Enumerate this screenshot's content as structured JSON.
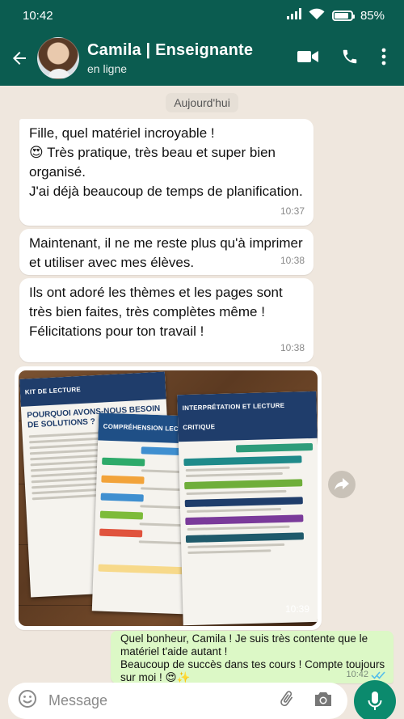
{
  "status_bar": {
    "time": "10:42",
    "battery": "85%",
    "battery_level": 0.85
  },
  "header": {
    "name": "Camila | Enseignante",
    "status": "en ligne"
  },
  "chat": {
    "date": "Aujourd'hui",
    "messages": [
      {
        "text": "Fille, quel matériel incroyable !\n😍 Très pratique, très beau et super bien organisé.\nJ'ai déjà beaucoup de temps de planification.",
        "time": "10:37"
      },
      {
        "text": "Maintenant, il ne me reste plus qu'à imprimer et utiliser avec mes élèves.",
        "time": "10:38"
      },
      {
        "text": "Ils ont adoré les thèmes et les pages sont très bien faites, très complètes même !\nFélicitations pour ton travail !",
        "time": "10:38"
      }
    ],
    "image_message": {
      "time": "10:39",
      "sheet_a": {
        "header": "KIT DE LECTURE",
        "title": "POURQUOI AVONS-NOUS BESOIN DE SOLUTIONS ?"
      },
      "sheet_b": {
        "header": "COMPRÉHENSION LECTORALE"
      },
      "sheet_c": {
        "header": "INTERPRÉTATION ET LECTURE CRITIQUE"
      }
    },
    "outgoing": {
      "text": "Quel bonheur, Camila ! Je suis très contente que le matériel t'aide autant !\nBeaucoup de succès dans tes cours ! Compte toujours sur moi ! 😍✨",
      "time": "10:42"
    }
  },
  "composer": {
    "placeholder": "Message"
  },
  "colors": {
    "header": "#0b5c50",
    "chat_bg": "#efe7de",
    "outgoing_bubble": "#dcf8c6",
    "mic_button": "#0b8a6d",
    "read_ticks": "#53bdeb"
  }
}
